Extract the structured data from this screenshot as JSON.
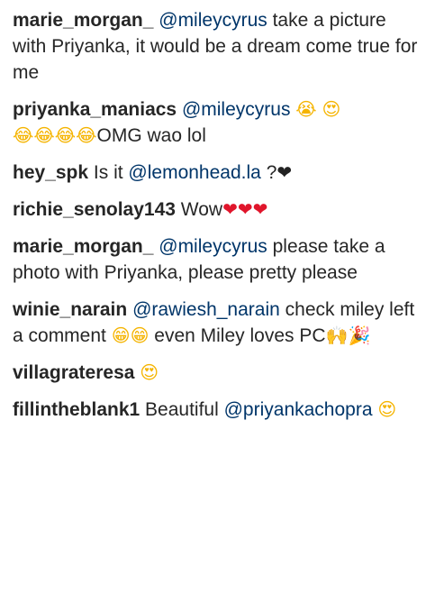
{
  "comments": [
    {
      "username": "marie_morgan_",
      "mention": "@mileycyrus",
      "text": "take a picture with Priyanka, it would be a dream come true for me"
    },
    {
      "username": "priyanka_maniacs",
      "mention": "@mileycyrus",
      "emojis_1": [
        "crying-face",
        "heart-eyes"
      ],
      "emojis_2": [
        "tears-of-joy",
        "tears-of-joy",
        "tears-of-joy",
        "tears-of-joy"
      ],
      "text": "OMG wao lol"
    },
    {
      "username": "hey_spk",
      "pre_text": "Is it",
      "mention": "@lemonhead.la",
      "post_text": "?",
      "emoji": "black-heart"
    },
    {
      "username": "richie_senolay143",
      "text": "Wow",
      "emojis": [
        "red-heart",
        "red-heart",
        "red-heart"
      ]
    },
    {
      "username": "marie_morgan_",
      "mention": "@mileycyrus",
      "text": "please take a photo with Priyanka, please pretty please"
    },
    {
      "username": "winie_narain",
      "mention": "@rawiesh_narain",
      "text_1": "check miley left a comment",
      "emojis": [
        "grinning-face",
        "grinning-face"
      ],
      "text_2": "even Miley loves PC",
      "emojis_2": [
        "raising-hands",
        "party-popper"
      ]
    },
    {
      "username": "villagrateresa",
      "emoji": "heart-eyes"
    },
    {
      "username": "fillintheblank1",
      "text": "Beautiful",
      "mention": "@priyankachopra",
      "emoji": "heart-eyes"
    }
  ],
  "colors": {
    "username": "#262626",
    "mention": "#003569",
    "text": "#262626",
    "background": "#ffffff"
  }
}
